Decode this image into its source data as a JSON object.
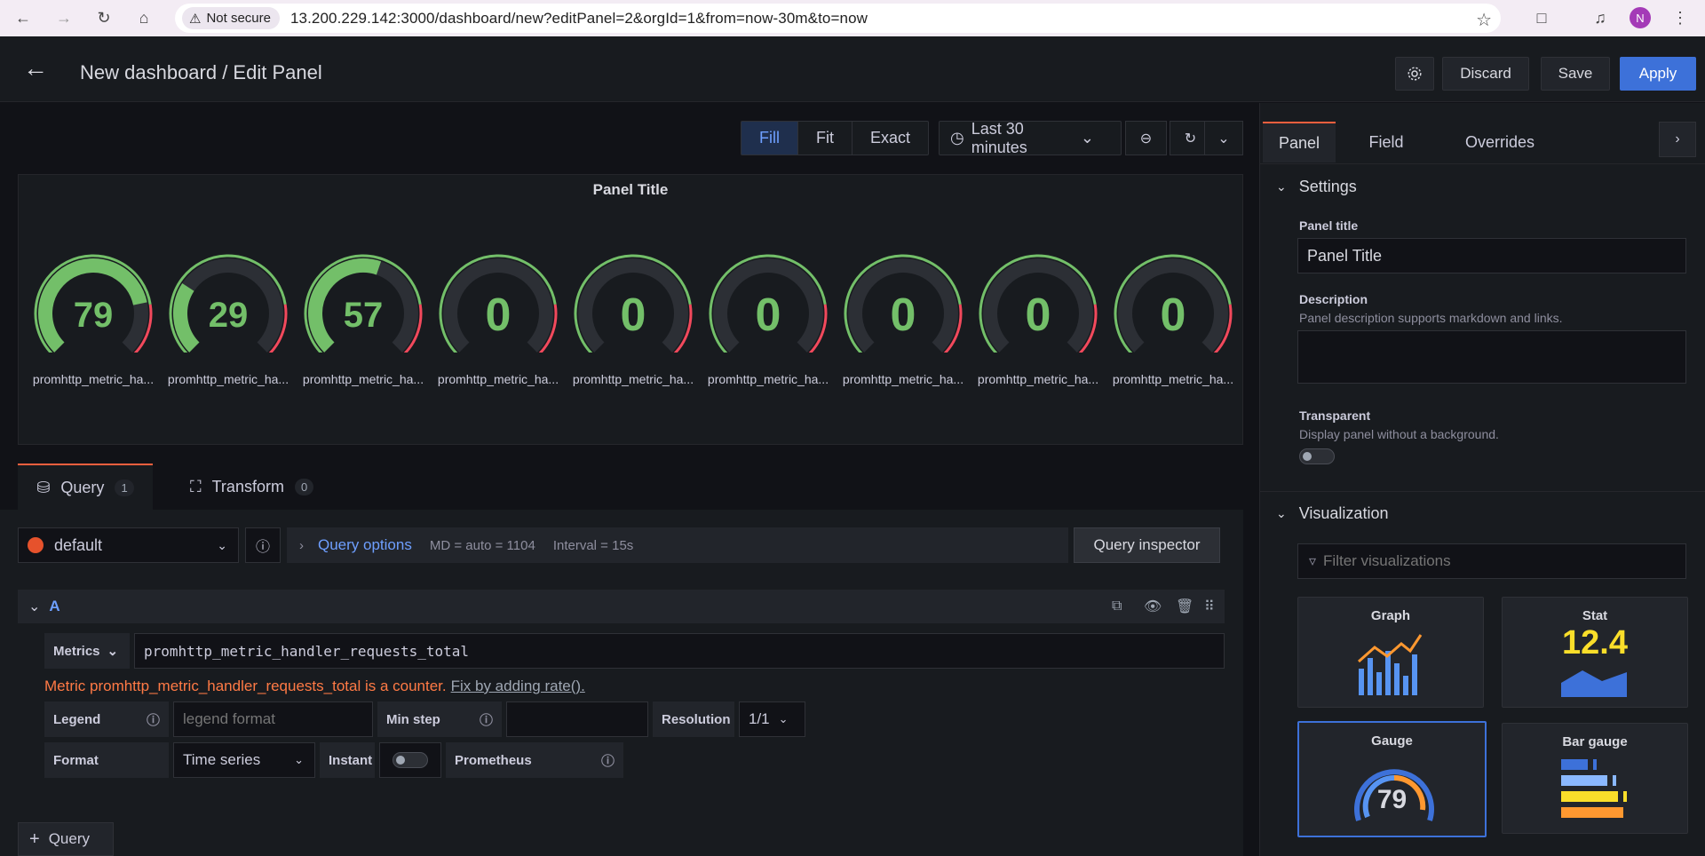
{
  "browser": {
    "not_secure": "Not secure",
    "url": "13.200.229.142:3000/dashboard/new?editPanel=2&orgId=1&from=now-30m&to=now",
    "profile_initial": "N"
  },
  "header": {
    "title": "New dashboard / Edit Panel",
    "discard": "Discard",
    "save": "Save",
    "apply": "Apply"
  },
  "toolbar": {
    "fill": "Fill",
    "fit": "Fit",
    "exact": "Exact",
    "time_range": "Last 30 minutes"
  },
  "panel": {
    "title": "Panel Title",
    "gauges": [
      {
        "value": "79",
        "fraction": 0.79,
        "label": "promhttp_metric_ha..."
      },
      {
        "value": "29",
        "fraction": 0.29,
        "label": "promhttp_metric_ha..."
      },
      {
        "value": "57",
        "fraction": 0.57,
        "label": "promhttp_metric_ha..."
      },
      {
        "value": "0",
        "fraction": 0,
        "label": "promhttp_metric_ha..."
      },
      {
        "value": "0",
        "fraction": 0,
        "label": "promhttp_metric_ha..."
      },
      {
        "value": "0",
        "fraction": 0,
        "label": "promhttp_metric_ha..."
      },
      {
        "value": "0",
        "fraction": 0,
        "label": "promhttp_metric_ha..."
      },
      {
        "value": "0",
        "fraction": 0,
        "label": "promhttp_metric_ha..."
      },
      {
        "value": "0",
        "fraction": 0,
        "label": "promhttp_metric_ha..."
      }
    ],
    "colors": {
      "green": "#73bf69",
      "red": "#f2495c",
      "track": "#2c2f35"
    }
  },
  "query_tabs": {
    "query_label": "Query",
    "query_count": "1",
    "transform_label": "Transform",
    "transform_count": "0"
  },
  "query": {
    "datasource": "default",
    "options_label": "Query options",
    "md": "MD = auto = 1104",
    "interval": "Interval = 15s",
    "inspector": "Query inspector",
    "ref_id": "A",
    "metrics_label": "Metrics",
    "expression": "promhttp_metric_handler_requests_total",
    "warning": "Metric promhttp_metric_handler_requests_total is a counter.",
    "fix_link": "Fix by adding rate().",
    "legend_label": "Legend",
    "legend_placeholder": "legend format",
    "min_step_label": "Min step",
    "resolution_label": "Resolution",
    "resolution_value": "1/1",
    "format_label": "Format",
    "format_value": "Time series",
    "instant_label": "Instant",
    "prometheus_label": "Prometheus",
    "add_query": "Query"
  },
  "right": {
    "tabs": [
      "Panel",
      "Field",
      "Overrides"
    ],
    "settings_title": "Settings",
    "panel_title_label": "Panel title",
    "panel_title_value": "Panel Title",
    "description_label": "Description",
    "description_help": "Panel description supports markdown and links.",
    "transparent_label": "Transparent",
    "transparent_help": "Display panel without a background.",
    "visualization_title": "Visualization",
    "filter_placeholder": "Filter visualizations",
    "vis": [
      {
        "name": "Graph"
      },
      {
        "name": "Stat",
        "sample": "12.4"
      },
      {
        "name": "Gauge",
        "sample": "79"
      },
      {
        "name": "Bar gauge"
      }
    ]
  }
}
